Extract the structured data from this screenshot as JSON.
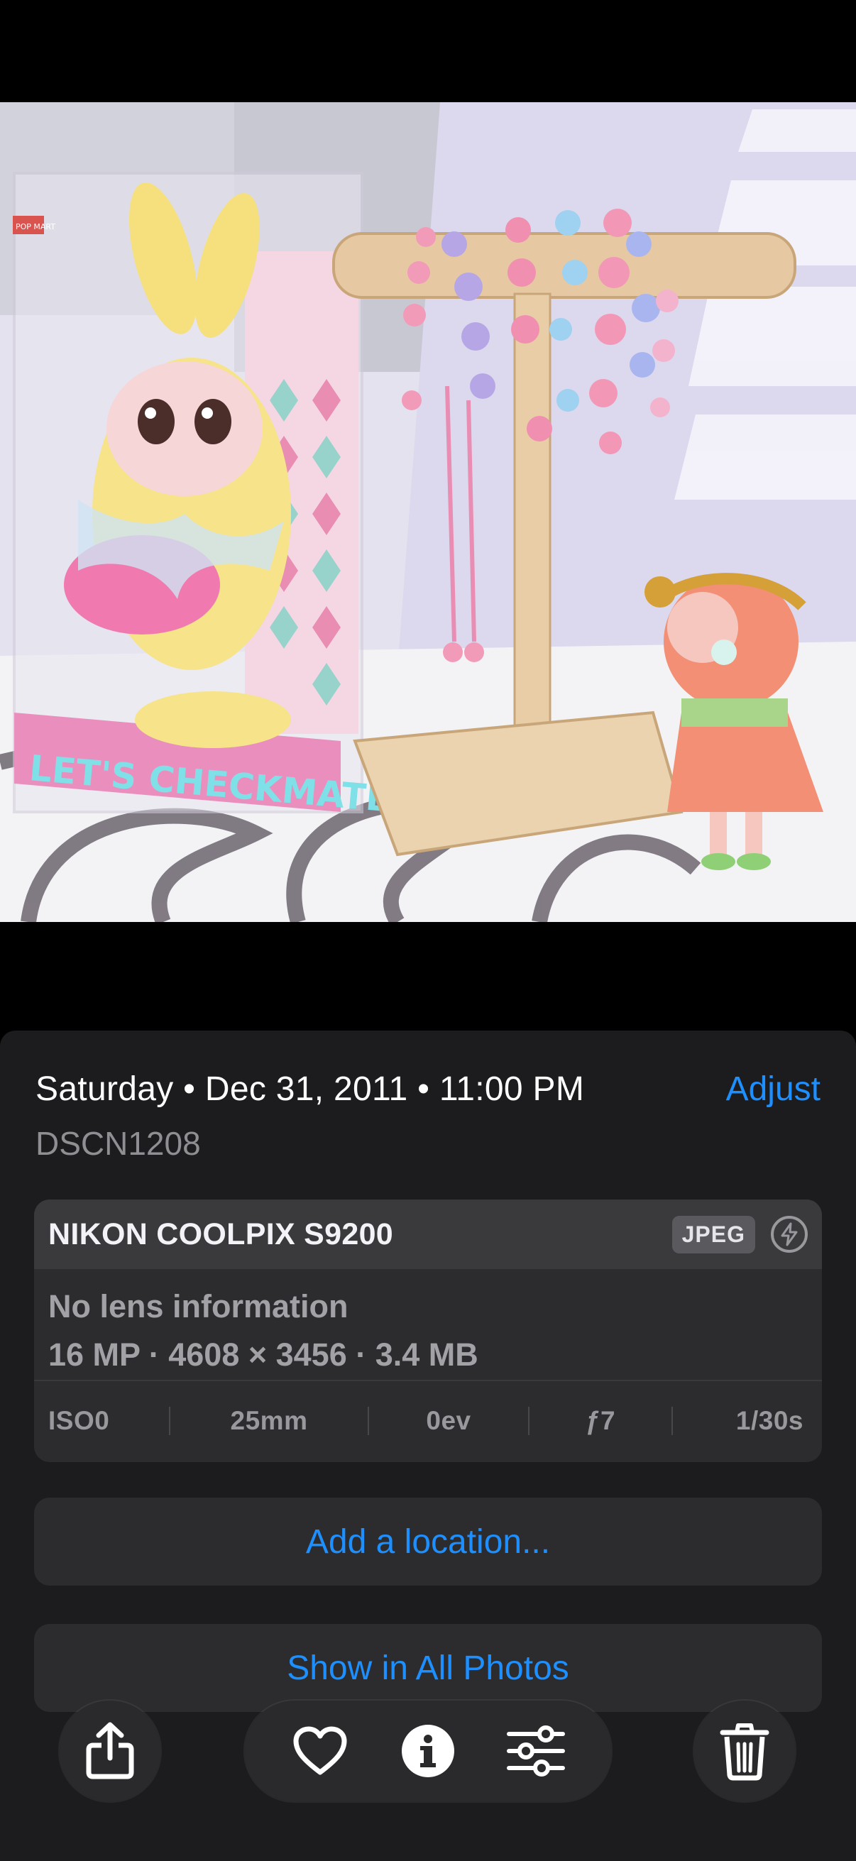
{
  "photo": {
    "box_text": "LET'S CHECKMATE",
    "brand_mark": "POP MART"
  },
  "info": {
    "date_line": "Saturday • Dec 31, 2011 • 11:00 PM",
    "adjust_label": "Adjust",
    "filename": "DSCN1208",
    "camera": {
      "model": "NIKON COOLPIX S9200",
      "format_badge": "JPEG",
      "flash_icon": "flash-off-icon",
      "lens": "No lens information",
      "specs": "16 MP · 4608 × 3456 · 3.4 MB"
    },
    "exif": {
      "iso": "ISO0",
      "focal": "25mm",
      "ev": "0ev",
      "aperture": "ƒ7",
      "shutter": "1/30s"
    },
    "add_location_label": "Add a location...",
    "show_all_label": "Show in All Photos"
  },
  "toolbar": {
    "share_icon": "share-icon",
    "favorite_icon": "heart-icon",
    "info_icon": "info-icon",
    "edit_icon": "sliders-icon",
    "delete_icon": "trash-icon"
  },
  "colors": {
    "accent": "#1d8fff",
    "sheet_bg": "#1c1c1e",
    "card_bg": "#2c2c2e"
  }
}
